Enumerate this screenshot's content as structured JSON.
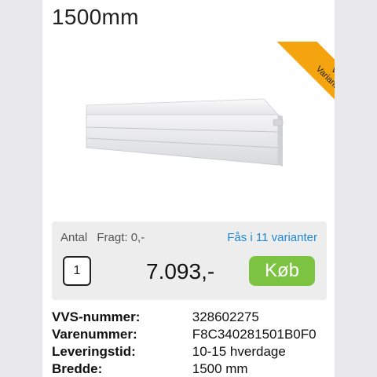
{
  "product": {
    "title": "1500mm"
  },
  "ribbon": {
    "label_line1": "Vis",
    "label_line2": "Varianter",
    "color": "#f4a40f"
  },
  "buy_panel": {
    "qty_label": "Antal",
    "shipping_label": "Fragt: 0,-",
    "variants_link": "Fås i 11 varianter",
    "quantity": "1",
    "price": "7.093,-",
    "buy_label": "Køb",
    "buy_color": "#7cc341",
    "link_color": "#1e88d8"
  },
  "specs": [
    {
      "label": "VVS-nummer:",
      "value": "328602275"
    },
    {
      "label": "Varenummer:",
      "value": "F8C340281501B0F0"
    },
    {
      "label": "Leveringstid:",
      "value": "10-15 hverdage"
    },
    {
      "label": "Bredde:",
      "value": "1500 mm"
    }
  ]
}
